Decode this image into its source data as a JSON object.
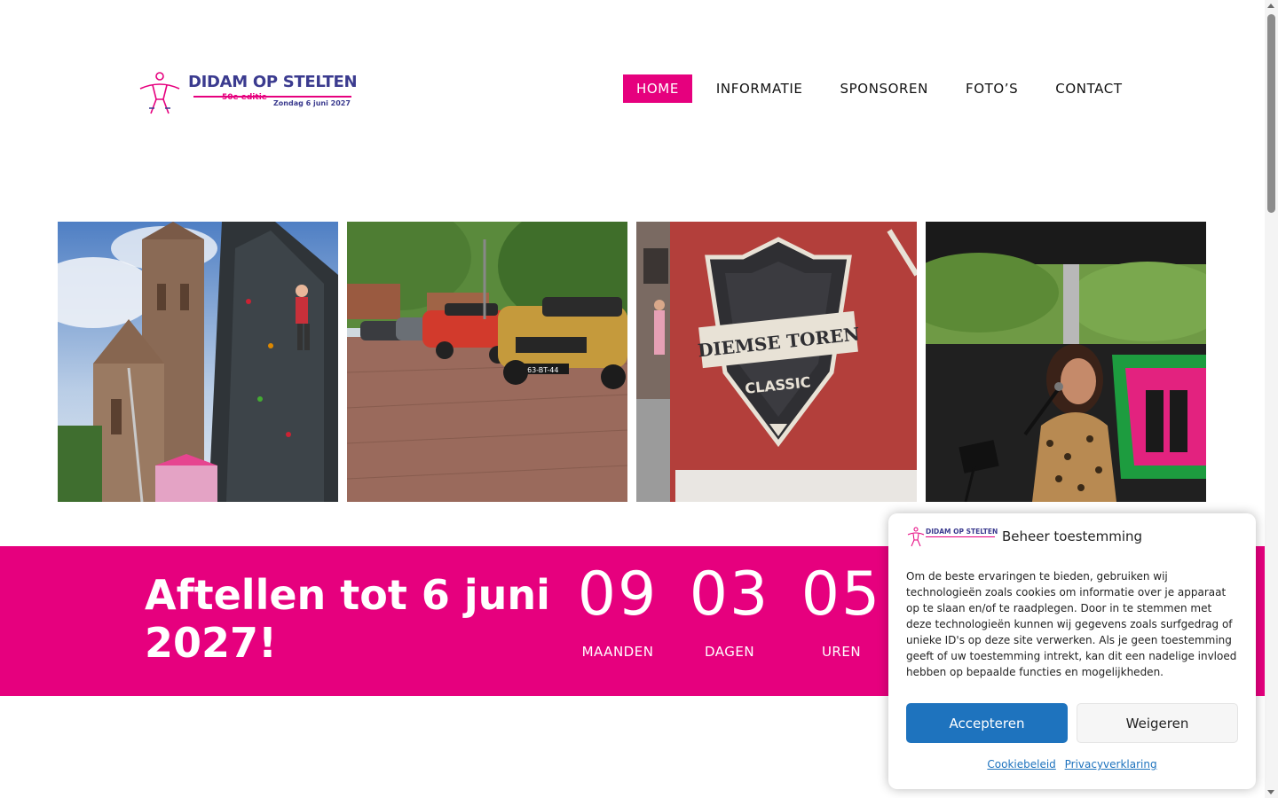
{
  "brand": {
    "name": "DIDAM OP STELTEN",
    "edition": "50e editie",
    "date": "Zondag 6 juni 2027",
    "pink": "#e6007e",
    "navy": "#3b3b8f"
  },
  "nav": {
    "items": [
      {
        "label": "HOME",
        "active": true
      },
      {
        "label": "INFORMATIE",
        "active": false
      },
      {
        "label": "SPONSOREN",
        "active": false
      },
      {
        "label": "FOTO’S",
        "active": false
      },
      {
        "label": "CONTACT",
        "active": false
      }
    ]
  },
  "gallery": {
    "photos": [
      {
        "subject": "climbing-wall-church-photo"
      },
      {
        "subject": "classic-cars-photo"
      },
      {
        "subject": "diemse-toren-banner-photo",
        "banner_text_1": "DIEMSE TOREN",
        "banner_text_2": "CLASSIC"
      },
      {
        "subject": "singer-on-stage-photo"
      }
    ],
    "car_plate": "63-BT-44"
  },
  "countdown": {
    "title": "Aftellen tot 6 juni 2027!",
    "units": [
      {
        "value": "09",
        "label": "MAANDEN"
      },
      {
        "value": "03",
        "label": "DAGEN"
      },
      {
        "value": "05",
        "label": "UREN"
      }
    ]
  },
  "cookie": {
    "title": "Beheer toestemming",
    "logo_text": "DIDAM OP STELTEN",
    "body": "Om de beste ervaringen te bieden, gebruiken wij technologieën zoals cookies om informatie over je apparaat op te slaan en/of te raadplegen. Door in te stemmen met deze technologieën kunnen wij gegevens zoals surfgedrag of unieke ID's op deze site verwerken. Als je geen toestemming geeft of uw toestemming intrekt, kan dit een nadelige invloed hebben op bepaalde functies en mogelijkheden.",
    "accept_label": "Accepteren",
    "deny_label": "Weigeren",
    "accept_color": "#1e73be",
    "links": [
      "Cookiebeleid",
      "Privacyverklaring"
    ]
  }
}
